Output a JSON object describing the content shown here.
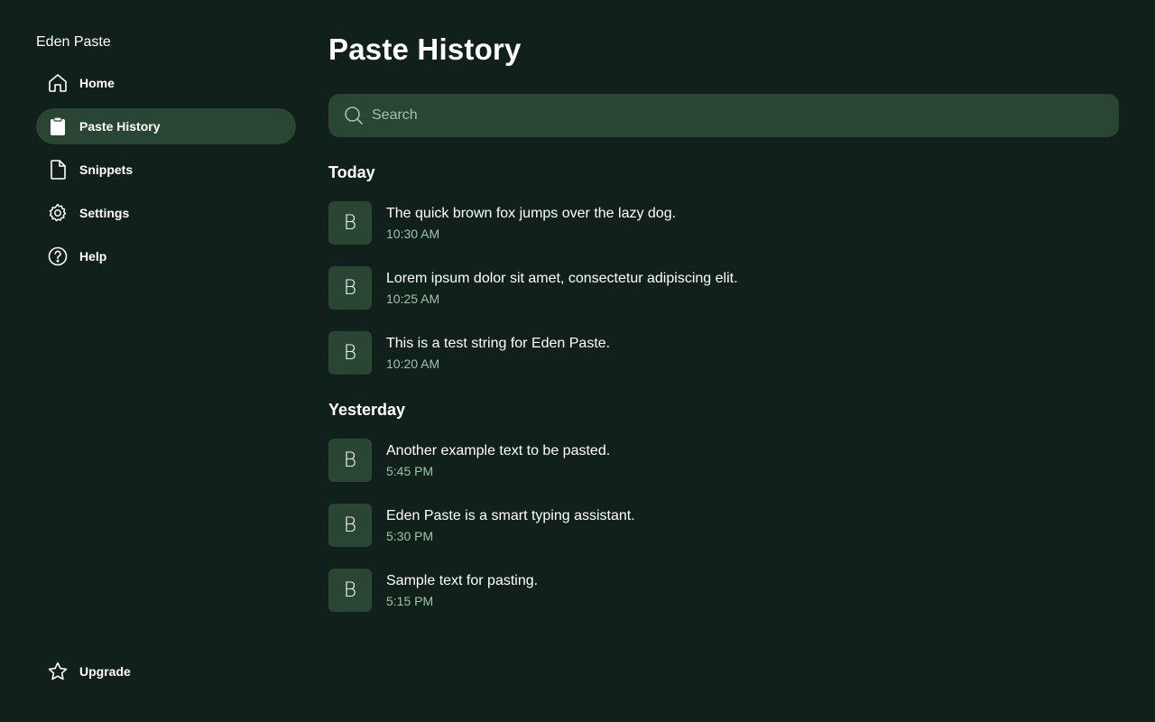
{
  "app": {
    "title": "Eden Paste"
  },
  "sidebar": {
    "items": [
      {
        "label": "Home",
        "icon": "home-icon",
        "active": false
      },
      {
        "label": "Paste History",
        "icon": "clipboard-icon",
        "active": true
      },
      {
        "label": "Snippets",
        "icon": "document-icon",
        "active": false
      },
      {
        "label": "Settings",
        "icon": "gear-icon",
        "active": false
      },
      {
        "label": "Help",
        "icon": "help-circle-icon",
        "active": false
      }
    ],
    "upgrade": {
      "label": "Upgrade",
      "icon": "star-icon"
    }
  },
  "main": {
    "title": "Paste History",
    "search": {
      "placeholder": "Search",
      "value": ""
    },
    "sections": [
      {
        "heading": "Today",
        "items": [
          {
            "avatar": "B",
            "text": "The quick brown fox jumps over the lazy dog.",
            "time": "10:30 AM"
          },
          {
            "avatar": "B",
            "text": "Lorem ipsum dolor sit amet, consectetur adipiscing elit.",
            "time": "10:25 AM"
          },
          {
            "avatar": "B",
            "text": "This is a test string for Eden Paste.",
            "time": "10:20 AM"
          }
        ]
      },
      {
        "heading": "Yesterday",
        "items": [
          {
            "avatar": "B",
            "text": "Another example text to be pasted.",
            "time": "5:45 PM"
          },
          {
            "avatar": "B",
            "text": "Eden Paste is a smart typing assistant.",
            "time": "5:30 PM"
          },
          {
            "avatar": "B",
            "text": "Sample text for pasting.",
            "time": "5:15 PM"
          }
        ]
      }
    ]
  },
  "colors": {
    "background": "#11201a",
    "surface": "#294635",
    "accent_text": "#9cc4aa",
    "text": "#ffffff"
  }
}
